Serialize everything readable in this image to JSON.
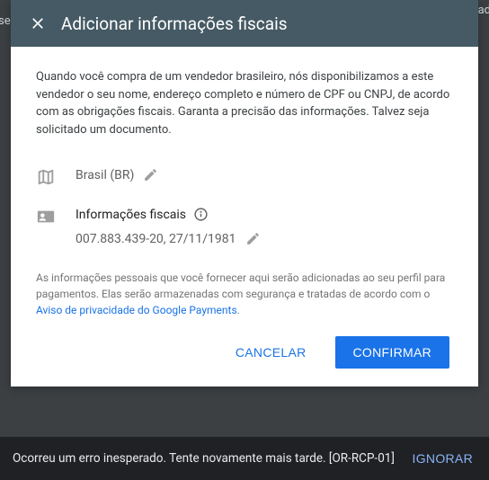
{
  "bg": {
    "left": "se",
    "right": "iitad"
  },
  "dialog": {
    "title": "Adicionar informações fiscais",
    "intro": "Quando você compra de um vendedor brasileiro, nós disponibilizamos a este vendedor o seu nome, endereço completo e número de CPF ou CNPJ, de acordo com as obrigações fiscais. Garanta a precisão das informações. Talvez seja solicitado um documento.",
    "country": {
      "value": "Brasil (BR)"
    },
    "tax": {
      "label": "Informações fiscais",
      "value": "007.883.439-20, 27/11/1981"
    },
    "footer": {
      "prefix": "As informações pessoais que você fornecer aqui serão adicionadas ao seu perfil para pagamentos. Elas serão armazenadas com segurança e tratadas de acordo com o ",
      "link": "Aviso de privacidade do Google Payments",
      "suffix": "."
    },
    "actions": {
      "cancel": "CANCELAR",
      "confirm": "CONFIRMAR"
    }
  },
  "snackbar": {
    "message": "Ocorreu um erro inesperado. Tente novamente mais tarde. [OR-RCP-01]",
    "action": "IGNORAR"
  }
}
